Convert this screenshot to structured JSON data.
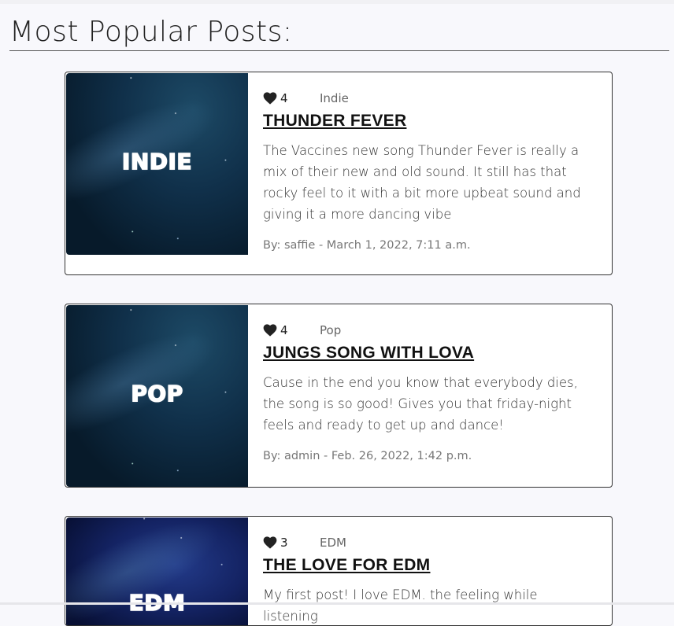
{
  "section": {
    "title": "Most Popular Posts:"
  },
  "posts": [
    {
      "thumbnail_label": "INDIE",
      "likes": "4",
      "category": "Indie",
      "title": "THUNDER FEVER",
      "excerpt": "The Vaccines new song Thunder Fever is really a mix of their new and old sound. It still has that rocky feel to it with a bit more upbeat sound and giving it a more dancing vibe",
      "byline": "By: saffie - March 1, 2022, 7:11 a.m."
    },
    {
      "thumbnail_label": "POP",
      "likes": "4",
      "category": "Pop",
      "title": "JUNGS SONG WITH LOVA",
      "excerpt": "Cause in the end you know that everybody dies, the song is so good! Gives you that friday-night feels and ready to get up and dance!",
      "byline": "By: admin - Feb. 26, 2022, 1:42 p.m."
    },
    {
      "thumbnail_label": "EDM",
      "likes": "3",
      "category": "EDM",
      "title": "THE LOVE FOR EDM",
      "excerpt": "My first post! I love EDM. the feeling while listening",
      "byline": ""
    }
  ],
  "icons": {
    "like": "heart-icon"
  },
  "colors": {
    "background": "#f8f8fc",
    "card_border": "#333333",
    "heart": "#222222"
  }
}
